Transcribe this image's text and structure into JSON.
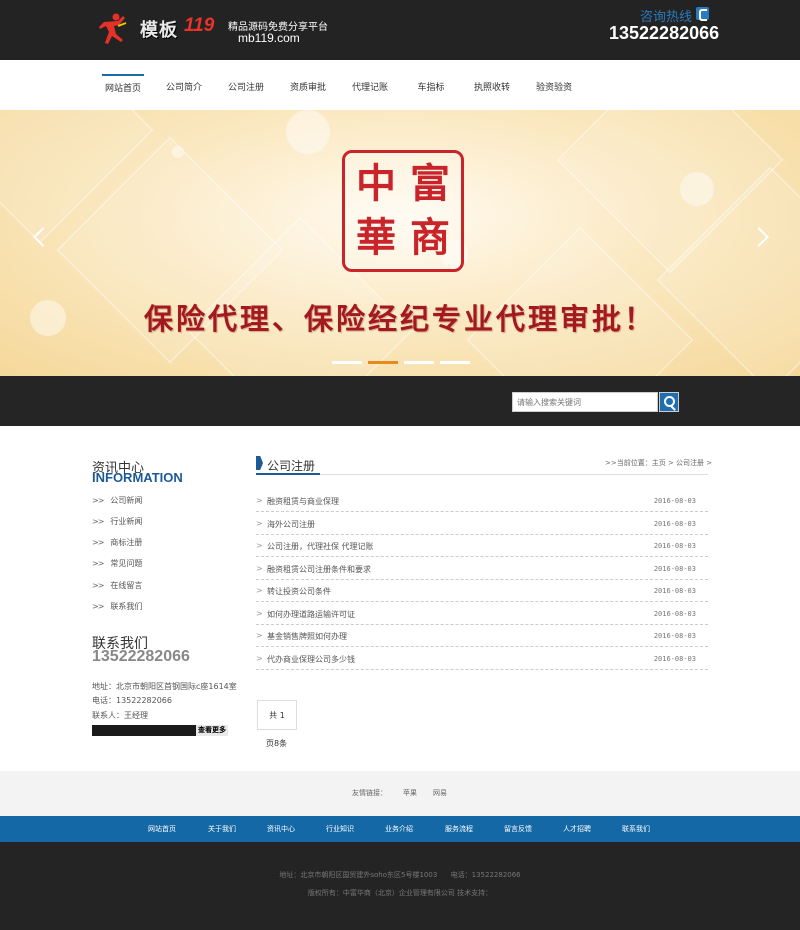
{
  "header": {
    "brand": "模板",
    "brand_num": "119",
    "tagline": "精品源码免费分享平台",
    "url": "mb119.com",
    "hotline_label": "咨询热线",
    "hotline": "13522282066"
  },
  "nav": {
    "items": [
      "网站首页",
      "公司简介",
      "公司注册",
      "资质审批",
      "代理记账",
      "车指标",
      "执照收转",
      "验资验资"
    ],
    "active_index": 0
  },
  "banner": {
    "seal_chars": [
      "中",
      "富",
      "華",
      "商"
    ],
    "slogan": "保险代理、保险经纪专业代理审批！",
    "slide_count": 4,
    "active_slide": 1,
    "seal_color": "#c9242a"
  },
  "search": {
    "placeholder": "请输入搜索关键词"
  },
  "sidebar": {
    "title": "资讯中心",
    "title_en": "INFORMATION",
    "items": [
      "公司新闻",
      "行业新闻",
      "商标注册",
      "常见问题",
      "在线留言",
      "联系我们"
    ],
    "contact_title": "联系我们",
    "contact_phone": "13522282066",
    "address": "地址：北京市朝阳区首钢国际c座1614室",
    "tel": "电话：13522282066",
    "person": "联系人：王经理",
    "more": "查看更多"
  },
  "main": {
    "title": "公司注册",
    "breadcrumb": ">>当前位置：主页 > 公司注册 >",
    "rows": [
      {
        "title": "融资租赁与商业保理",
        "date": "2016-08-03"
      },
      {
        "title": "海外公司注册",
        "date": "2016-08-03"
      },
      {
        "title": "公司注册，代理社保 代理记账",
        "date": "2016-08-03"
      },
      {
        "title": "融资租赁公司注册条件和要求",
        "date": "2016-08-03"
      },
      {
        "title": "转让投资公司条件",
        "date": "2016-08-03"
      },
      {
        "title": "如何办理道路运输许可证",
        "date": "2016-08-03"
      },
      {
        "title": "基金销售牌照如何办理",
        "date": "2016-08-03"
      },
      {
        "title": "代办商业保理公司多少钱",
        "date": "2016-08-03"
      }
    ],
    "pager": "共 1",
    "total": "页8条"
  },
  "footer": {
    "links_label": "友情链接：",
    "links": [
      "苹果",
      "网易"
    ],
    "nav": [
      "网站首页",
      "关于我们",
      "资讯中心",
      "行业知识",
      "业务介绍",
      "服务流程",
      "留言反馈",
      "人才招聘",
      "联系我们"
    ],
    "address": "地址：北京市朝阳区国贸建外soho东区5号楼1003",
    "tel": "电话：13522282066",
    "copyright": "版权所有：中富华商（北京）企业管理有限公司 技术支持："
  },
  "colors": {
    "accent": "#1b5a94",
    "nav_blue": "#1468a6",
    "dark": "#232323",
    "slide_active": "#e78a1e"
  }
}
